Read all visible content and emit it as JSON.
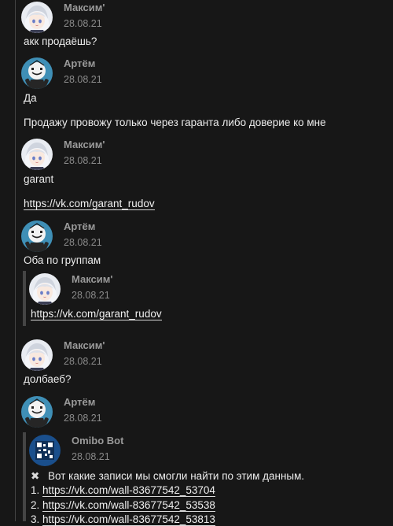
{
  "messages": [
    {
      "author": "Максим'",
      "date": "28.08.21",
      "text": "акк продаёшь?"
    },
    {
      "author": "Артём",
      "date": "28.08.21",
      "text": "Да",
      "text2": "Продажу провожу только через гаранта либо доверие ко мне"
    },
    {
      "author": "Максим'",
      "date": "28.08.21",
      "text": "garant",
      "link": "https://vk.com/garant_rudov"
    },
    {
      "author": "Артём",
      "date": "28.08.21",
      "text": "Оба по группам",
      "quote": {
        "author": "Максим'",
        "date": "28.08.21",
        "link": "https://vk.com/garant_rudov"
      }
    },
    {
      "author": "Максим'",
      "date": "28.08.21",
      "text": "долбаеб?"
    },
    {
      "author": "Артём",
      "date": "28.08.21",
      "quote": {
        "author": "Omibo Bot",
        "date": "28.08.21",
        "text": "Вот какие записи мы смогли найти по этим данным.",
        "results": [
          {
            "num": "1.",
            "link": "https://vk.com/wall-83677542_53704"
          },
          {
            "num": "2.",
            "link": "https://vk.com/wall-83677542_53538"
          },
          {
            "num": "3.",
            "link": "https://vk.com/wall-83677542_53813"
          }
        ]
      }
    }
  ],
  "colors": {
    "background": "#171717",
    "author": "#9a9a9a",
    "date": "#8a8a8a",
    "text": "#ececec",
    "avatar_artem_bg": "#3f8fb6",
    "avatar_omibo_bg": "#1a4f8c"
  },
  "icons": {
    "result_marker": "pin-icon",
    "avatar_maksim": "anime-girl-avatar-icon",
    "avatar_artem": "marshmello-avatar-icon",
    "avatar_omibo": "qr-code-avatar-icon"
  }
}
